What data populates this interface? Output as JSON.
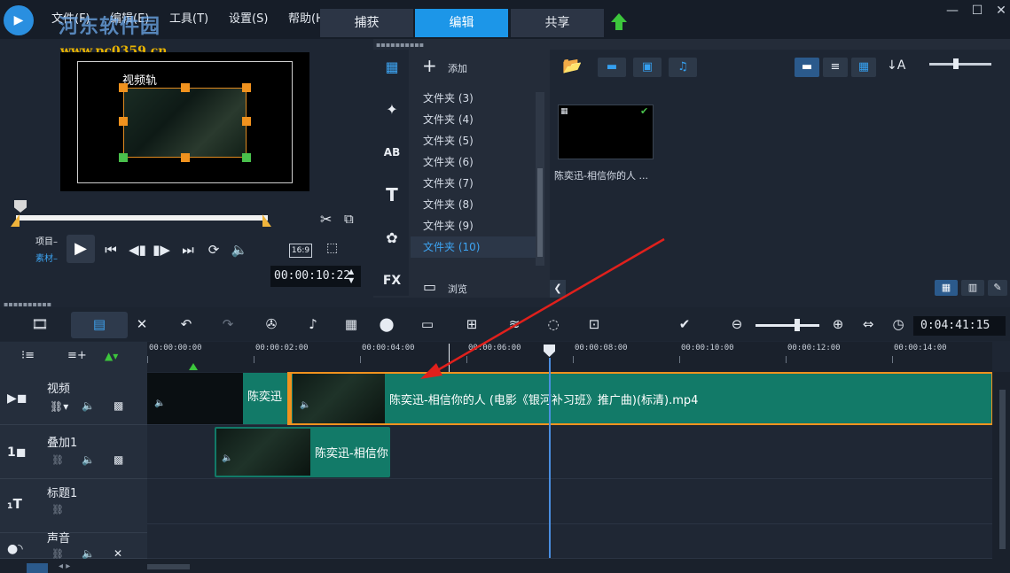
{
  "menu": {
    "file": "文件(F)",
    "edit": "编辑(E)",
    "tools": "工具(T)",
    "settings": "设置(S)",
    "help": "帮助(H)"
  },
  "watermark": {
    "title": "河东软件园",
    "url": "www.pc0359.cn"
  },
  "mode_tabs": [
    "捕获",
    "编辑",
    "共享"
  ],
  "active_mode_tab": "编辑",
  "window_controls": {
    "minimize": "—",
    "maximize": "☐",
    "close": "✕"
  },
  "preview": {
    "overlay_label": "视频轨",
    "project_label": "项目",
    "clip_label": "素材",
    "aspect_ratio": "16:9",
    "timecode": "00:00:10:22"
  },
  "library": {
    "add_label": "添加",
    "browse_label": "浏览",
    "folders": [
      "文件夹 (3)",
      "文件夹 (4)",
      "文件夹 (5)",
      "文件夹 (6)",
      "文件夹 (7)",
      "文件夹 (8)",
      "文件夹 (9)",
      "文件夹 (10)"
    ],
    "selected_folder": "文件夹 (10)",
    "media_caption": "陈奕迅-相信你的人 ..."
  },
  "timeline": {
    "timecode": "0:04:41:15",
    "ruler_labels": [
      "00:00:00:00",
      "00:00:02:00",
      "00:00:04:00",
      "00:00:06:00",
      "00:00:08:00",
      "00:00:10:00",
      "00:00:12:00",
      "00:00:14:00"
    ],
    "tracks": [
      {
        "name": "视频"
      },
      {
        "name": "叠加1"
      },
      {
        "name": "标题1"
      },
      {
        "name": "声音"
      }
    ],
    "clips": {
      "video_clip_short": "陈奕迅",
      "video_clip_main": "陈奕迅-相信你的人 (电影《银河补习班》推广曲)(标清).mp4",
      "overlay_clip": "陈奕迅-相信你"
    }
  },
  "colors": {
    "accent_blue": "#1c96e8",
    "clip_teal": "#127a68",
    "handle_orange": "#f0921e",
    "annotation_red": "#e0201c"
  }
}
